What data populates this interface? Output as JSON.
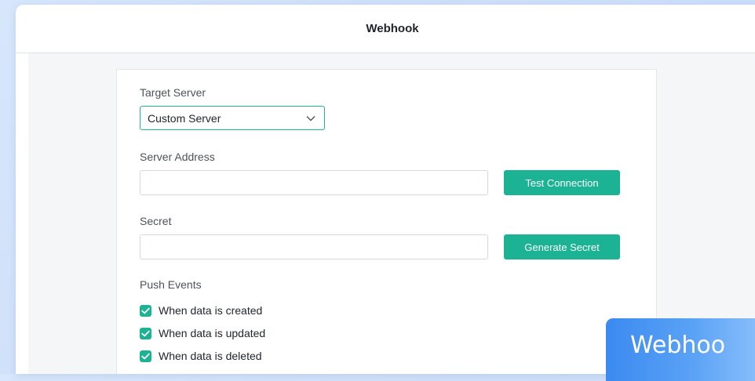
{
  "window": {
    "title": "Webhook"
  },
  "form": {
    "target_server": {
      "label": "Target Server",
      "value": "Custom Server"
    },
    "server_address": {
      "label": "Server Address",
      "value": "",
      "button": "Test Connection"
    },
    "secret": {
      "label": "Secret",
      "value": "",
      "button": "Generate Secret"
    },
    "push_events": {
      "label": "Push Events",
      "options": [
        {
          "label": "When data is created",
          "checked": true
        },
        {
          "label": "When data is updated",
          "checked": true
        },
        {
          "label": "When data is deleted",
          "checked": true
        }
      ]
    }
  },
  "badge": {
    "text": "Webhoo"
  },
  "colors": {
    "accent": "#1cb394",
    "badge": "#4a95f3"
  }
}
